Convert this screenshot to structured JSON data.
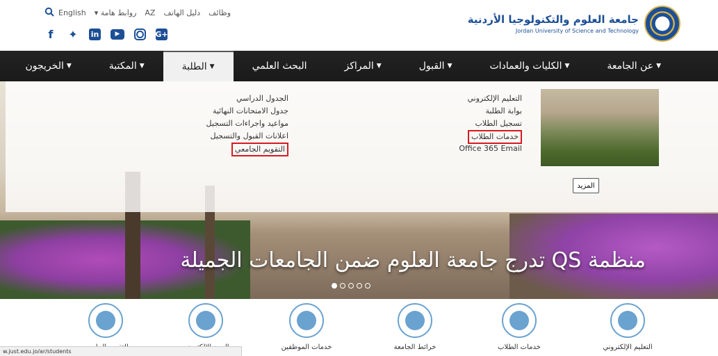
{
  "header": {
    "top_links": [
      "English",
      "روابط هامة",
      "AZ",
      "دليل الهاتف",
      "وظائف"
    ],
    "brand_ar": "جامعة العلوم والتكنولوجيا الأردنية",
    "brand_en": "Jordan University of Science and Technology",
    "social_icons": [
      "facebook-icon",
      "twitter-icon",
      "linkedin-icon",
      "youtube-icon",
      "instagram-icon",
      "google-plus-icon"
    ]
  },
  "nav": {
    "items": [
      {
        "label": "عن الجامعة",
        "caret": true
      },
      {
        "label": "الكليات والعمادات",
        "caret": true
      },
      {
        "label": "القبول",
        "caret": true
      },
      {
        "label": "المراكز",
        "caret": true
      },
      {
        "label": "البحث العلمي",
        "caret": false
      },
      {
        "label": "الطلبة",
        "caret": true,
        "active": true
      },
      {
        "label": "المكتبة",
        "caret": true
      },
      {
        "label": "الخريجون",
        "caret": true
      }
    ]
  },
  "mega": {
    "col_right": [
      "التعليم الإلكتروني",
      "بوابة الطلبة",
      "تسجيل الطلاب",
      "خدمات الطلاب",
      "Office 365 Email"
    ],
    "col_left": [
      "الجدول الدراسي",
      "جدول الامتحانات النهائية",
      "مواعيد واجراءات التسجيل",
      "اعلانات القبول والتسجيل",
      "التقويم الجامعي"
    ],
    "more": "المزيد"
  },
  "hero": {
    "title": "منظمة QS تدرج جامعة العلوم ضمن الجامعات الجميلة",
    "dots": 5,
    "active_dot": 1
  },
  "features": [
    {
      "label": "التقويم الجامعي",
      "icon": "calendar-icon"
    },
    {
      "label": "البريد الالكتروني",
      "icon": "email-icon"
    },
    {
      "label": "خدمات الموظفين",
      "icon": "people-icon"
    },
    {
      "label": "خرائط الجامعة",
      "icon": "map-pin-icon"
    },
    {
      "label": "خدمات الطلاب",
      "icon": "student-icon"
    },
    {
      "label": "التعليم الإلكتروني",
      "icon": "elearning-icon"
    }
  ],
  "status_bar": "w.just.edu.jo/ar/students"
}
